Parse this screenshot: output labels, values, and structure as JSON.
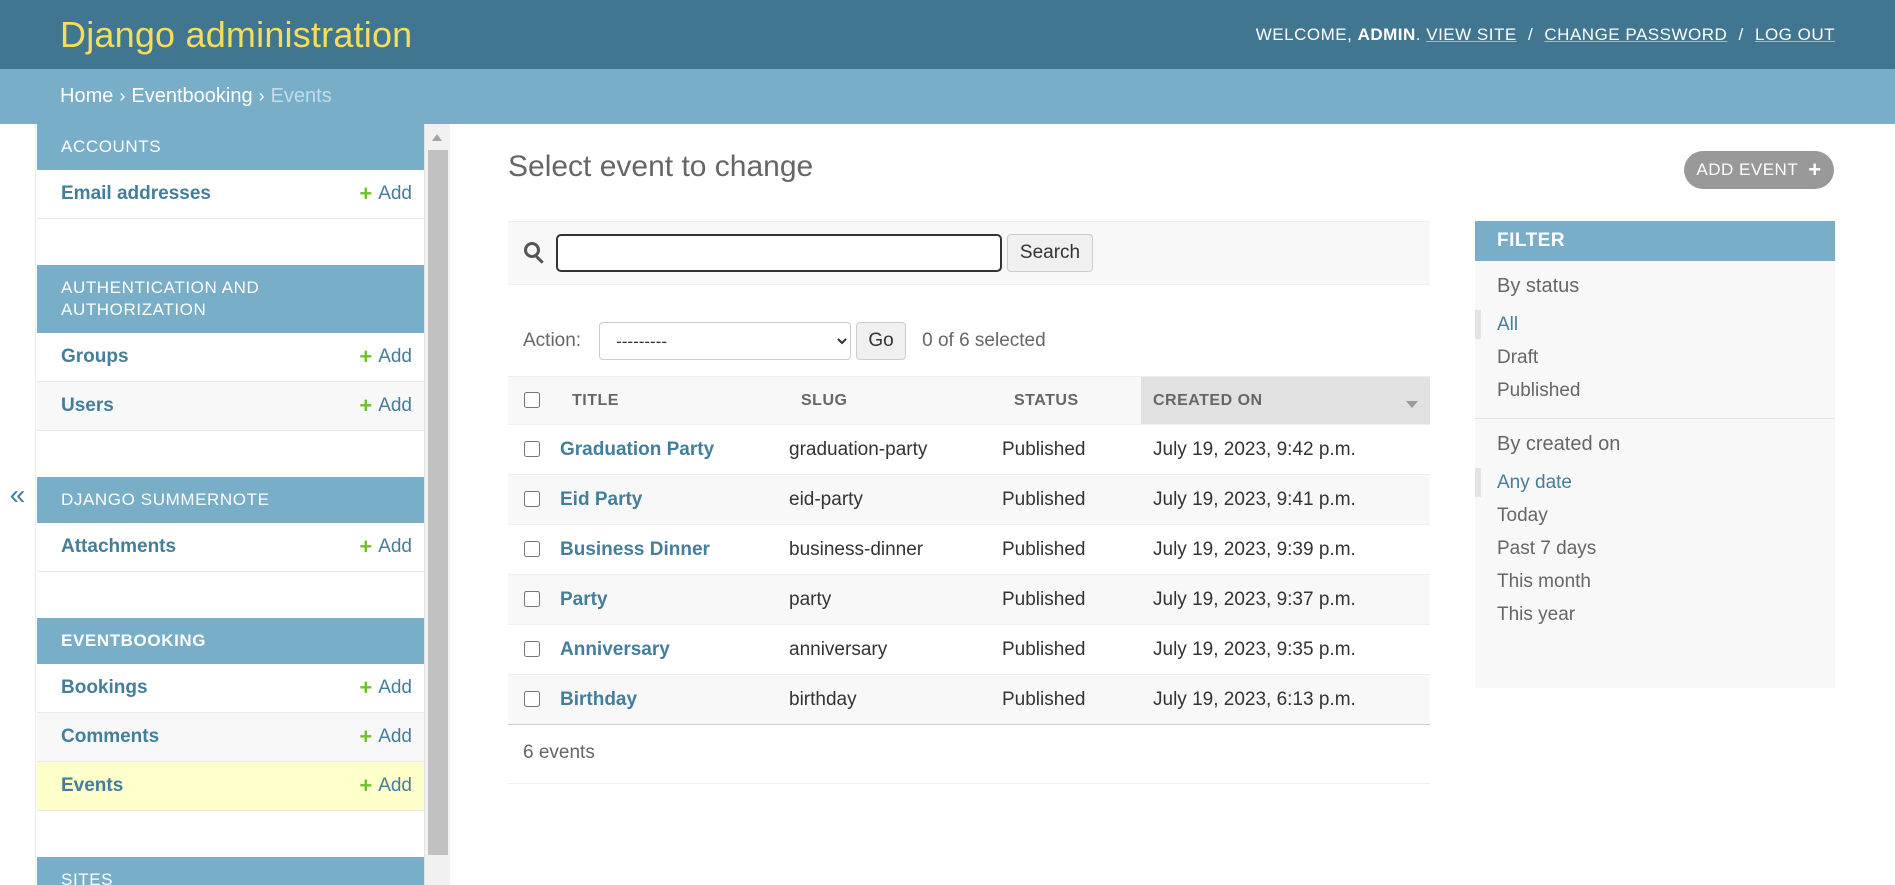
{
  "header": {
    "site_name": "Django administration",
    "welcome": "WELCOME, ",
    "username": "ADMIN",
    "view_site": "VIEW SITE",
    "change_password": "CHANGE PASSWORD",
    "logout": "LOG OUT"
  },
  "breadcrumbs": [
    "Home",
    "Eventbooking",
    "Events"
  ],
  "nav_toggle": "«",
  "sidebar": {
    "add_label": "Add",
    "modules": [
      {
        "caption": "ACCOUNTS",
        "models": [
          "Email addresses"
        ]
      },
      {
        "caption": "AUTHENTICATION AND AUTHORIZATION",
        "models": [
          "Groups",
          "Users"
        ]
      },
      {
        "caption": "DJANGO SUMMERNOTE",
        "models": [
          "Attachments"
        ]
      },
      {
        "caption": "EVENTBOOKING",
        "models": [
          "Bookings",
          "Comments",
          "Events"
        ],
        "current_model": "Events"
      },
      {
        "caption": "SITES",
        "models": []
      }
    ]
  },
  "main": {
    "title": "Select event to change",
    "add_button": "ADD EVENT",
    "search": {
      "value": "",
      "button": "Search"
    },
    "actions": {
      "label": "Action:",
      "selected": "---------",
      "go": "Go",
      "counter": "0 of 6 selected"
    },
    "columns": [
      "TITLE",
      "SLUG",
      "STATUS",
      "CREATED ON"
    ],
    "sorted_column": "CREATED ON",
    "rows": [
      {
        "title": "Graduation Party",
        "slug": "graduation-party",
        "status": "Published",
        "created_on": "July 19, 2023, 9:42 p.m."
      },
      {
        "title": "Eid Party",
        "slug": "eid-party",
        "status": "Published",
        "created_on": "July 19, 2023, 9:41 p.m."
      },
      {
        "title": "Business Dinner",
        "slug": "business-dinner",
        "status": "Published",
        "created_on": "July 19, 2023, 9:39 p.m."
      },
      {
        "title": "Party",
        "slug": "party",
        "status": "Published",
        "created_on": "July 19, 2023, 9:37 p.m."
      },
      {
        "title": "Anniversary",
        "slug": "anniversary",
        "status": "Published",
        "created_on": "July 19, 2023, 9:35 p.m."
      },
      {
        "title": "Birthday",
        "slug": "birthday",
        "status": "Published",
        "created_on": "July 19, 2023, 6:13 p.m."
      }
    ],
    "paginator": "6 events"
  },
  "filter": {
    "title": "FILTER",
    "groups": [
      {
        "heading": "By status",
        "options": [
          "All",
          "Draft",
          "Published"
        ],
        "selected": "All"
      },
      {
        "heading": "By created on",
        "options": [
          "Any date",
          "Today",
          "Past 7 days",
          "This month",
          "This year"
        ],
        "selected": "Any date"
      }
    ]
  },
  "colors": {
    "header_bg": "#417690",
    "breadcrumb_bg": "#79aec8",
    "site_name": "#f5dd5d",
    "link": "#447e9b",
    "add_plus": "#70bf2b",
    "selected_row": "#ffffcc"
  }
}
